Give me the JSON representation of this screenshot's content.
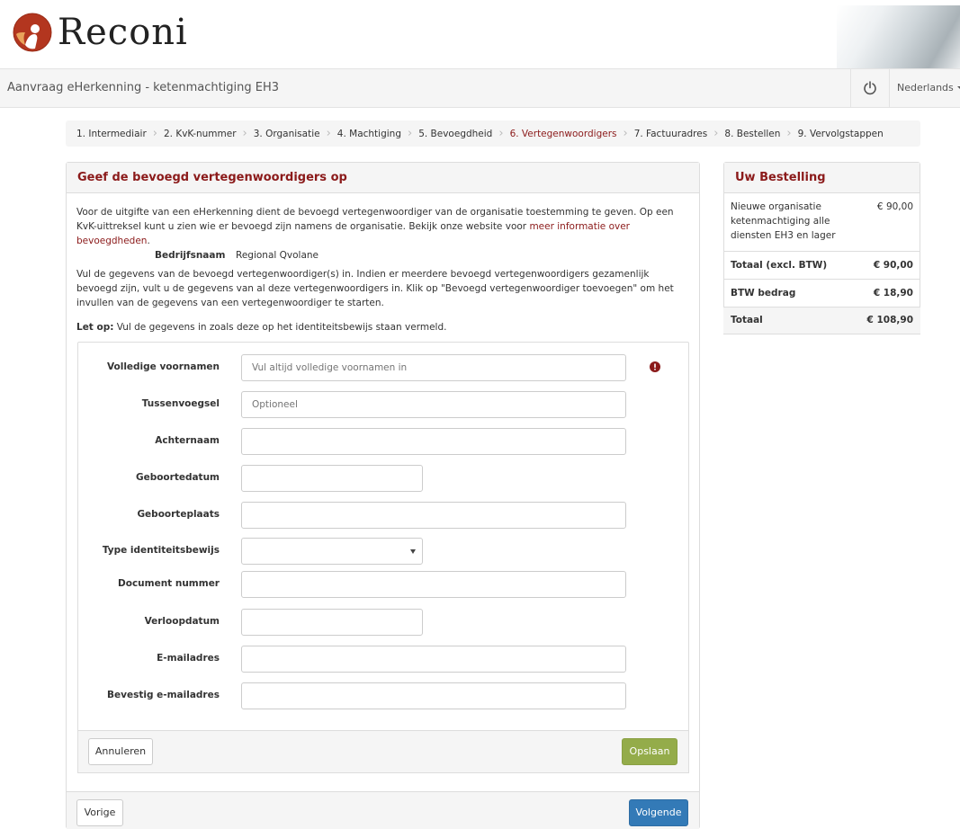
{
  "brand": {
    "name": "Reconi",
    "accent": "#8b1a1a",
    "logo_icon": "reconi-logo-icon"
  },
  "topbar": {
    "title": "Aanvraag eHerkenning - ketenmachtiging EH3",
    "power_icon": "power-icon",
    "language": "Nederlands"
  },
  "steps": [
    {
      "label": "1. Intermediair",
      "active": false
    },
    {
      "label": "2. KvK-nummer",
      "active": false
    },
    {
      "label": "3. Organisatie",
      "active": false
    },
    {
      "label": "4. Machtiging",
      "active": false
    },
    {
      "label": "5. Bevoegdheid",
      "active": false
    },
    {
      "label": "6. Vertegenwoordigers",
      "active": true
    },
    {
      "label": "7. Factuuradres",
      "active": false
    },
    {
      "label": "8. Bestellen",
      "active": false
    },
    {
      "label": "9. Vervolgstappen",
      "active": false
    }
  ],
  "main": {
    "heading": "Geef de bevoegd vertegenwoordigers op",
    "intro_text": "Voor de uitgifte van een eHerkenning dient de bevoegd vertegenwoordiger van de organisatie toestemming te geven. Op een KvK-uittreksel kunt u zien wie er bevoegd zijn namens de organisatie. Bekijk onze website voor ",
    "intro_link": "meer informatie over bevoegdheden",
    "intro_end": ".",
    "company_label": "Bedrijfsnaam",
    "company_value": "Regional Qvolane",
    "instructions": "Vul de gegevens van de bevoegd vertegenwoordiger(s) in. Indien er meerdere bevoegd vertegenwoordigers gezamenlijk bevoegd zijn, vult u de gegevens van al deze vertegenwoordigers in. Klik op \"Bevoegd vertegenwoordiger toevoegen\" om het invullen van de gegevens van een vertegenwoordiger te starten.",
    "note_bold": "Let op:",
    "note_text": " Vul de gegevens in zoals deze op het identiteitsbewijs staan vermeld."
  },
  "form": {
    "first_names": {
      "label": "Volledige voornamen",
      "placeholder": "Vul altijd volledige voornamen in",
      "value": ""
    },
    "prefix": {
      "label": "Tussenvoegsel",
      "placeholder": "Optioneel",
      "value": ""
    },
    "last_name": {
      "label": "Achternaam",
      "value": ""
    },
    "birth_date": {
      "label": "Geboortedatum",
      "value": ""
    },
    "birth_place": {
      "label": "Geboorteplaats",
      "value": ""
    },
    "id_type": {
      "label": "Type identiteitsbewijs",
      "value": ""
    },
    "doc_number": {
      "label": "Document nummer",
      "value": ""
    },
    "expiry_date": {
      "label": "Verloopdatum",
      "value": ""
    },
    "email": {
      "label": "E-mailadres",
      "value": ""
    },
    "email_confirm": {
      "label": "Bevestig e-mailadres",
      "value": ""
    },
    "info_icon": "exclamation-circle-icon",
    "cancel_label": "Annuleren",
    "save_label": "Opslaan"
  },
  "nav": {
    "prev_label": "Vorige",
    "next_label": "Volgende"
  },
  "order": {
    "heading": "Uw Bestelling",
    "item_desc": "Nieuwe organisatie ketenmachtiging alle diensten EH3 en lager",
    "item_amount": "€ 90,00",
    "subtotal_label": "Totaal (excl. BTW)",
    "subtotal_amount": "€ 90,00",
    "vat_label": "BTW bedrag",
    "vat_amount": "€ 18,90",
    "total_label": "Totaal",
    "total_amount": "€ 108,90"
  }
}
